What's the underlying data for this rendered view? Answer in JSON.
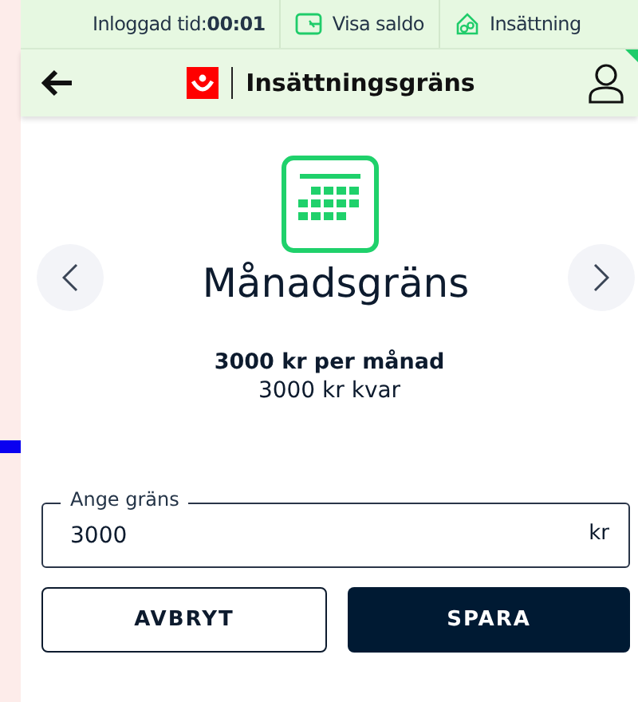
{
  "top_bar": {
    "items": [
      {
        "kind": "timer",
        "text": "Inloggad tid:**00:01**"
      },
      {
        "kind": "wallet",
        "text": "Visa saldo"
      },
      {
        "kind": "deposit",
        "text": "Insättning"
      }
    ]
  },
  "header": {
    "title": "Insättningsgräns"
  },
  "limit": {
    "title": "Månadsgräns",
    "amount": "3000 kr per månad",
    "remaining": "3000 kr kvar"
  },
  "field": {
    "label": "Ange gräns",
    "value": "3000",
    "unit": "kr"
  },
  "buttons": [
    {
      "kind": "secondary",
      "label": "AVBRYT"
    },
    {
      "kind": "primary",
      "label": "SPARA"
    }
  ]
}
